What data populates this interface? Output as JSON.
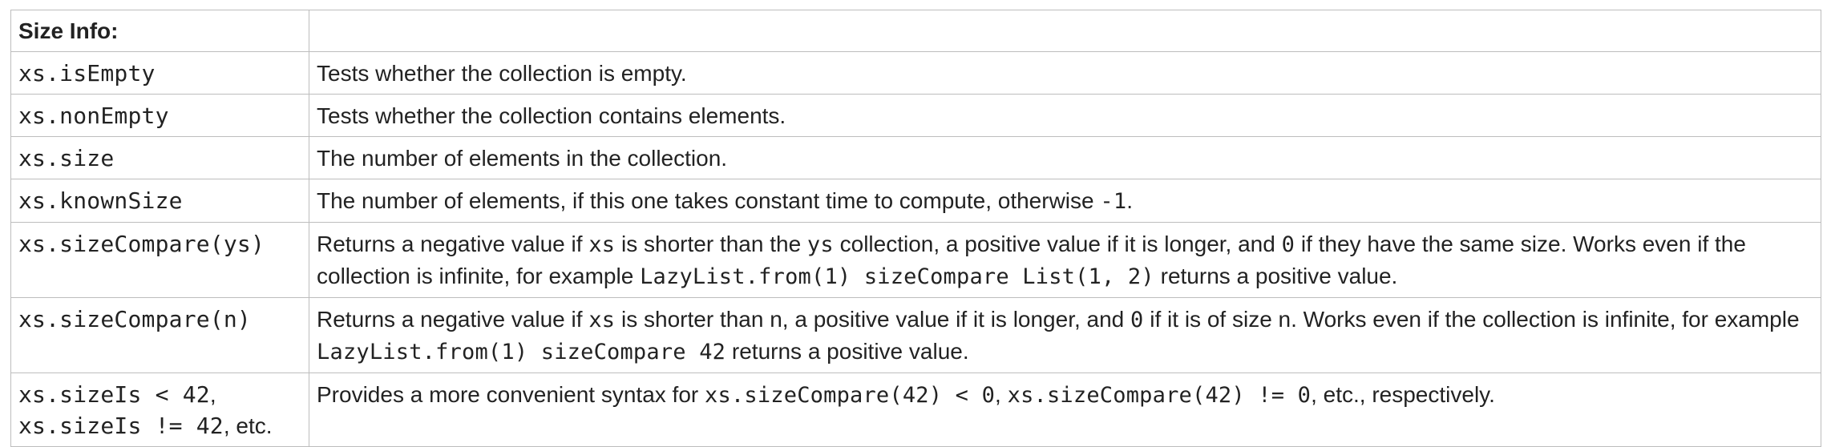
{
  "header": {
    "title": "Size Info:",
    "empty": ""
  },
  "rows": [
    {
      "op": "xs.isEmpty",
      "desc": "Tests whether the collection is empty."
    },
    {
      "op": "xs.nonEmpty",
      "desc": "Tests whether the collection contains elements."
    },
    {
      "op": "xs.size",
      "desc": "The number of elements in the collection."
    },
    {
      "op": "xs.knownSize",
      "desc_a": "The number of elements, if this one takes constant time to compute, otherwise ",
      "desc_code": "-1",
      "desc_b": "."
    },
    {
      "op": "xs.sizeCompare(ys)",
      "p1": "Returns a negative value if ",
      "c1": "xs",
      "p2": " is shorter than the ",
      "c2": "ys",
      "p3": " collection, a positive value if it is longer, and ",
      "c3": "0",
      "p4": " if they have the same size. Works even if the collection is infinite, for example ",
      "c4": "LazyList.from(1) sizeCompare List(1, 2)",
      "p5": " returns a positive value."
    },
    {
      "op": "xs.sizeCompare(n)",
      "p1": "Returns a negative value if ",
      "c1": "xs",
      "p2": " is shorter than n, a positive value if it is longer, and ",
      "c2": "0",
      "p3": " if it is of size n. Works even if the collection is infinite, for example ",
      "c3": "LazyList.from(1) sizeCompare 42",
      "p4": " returns a positive value."
    },
    {
      "op_a": "xs.sizeIs < 42",
      "op_sep": ",",
      "op_b": "xs.sizeIs != 42",
      "op_tail": ", etc.",
      "p1": "Provides a more convenient syntax for ",
      "c1": "xs.sizeCompare(42) < 0",
      "p2": ", ",
      "c2": "xs.sizeCompare(42) != 0",
      "p3": ", etc., respectively."
    }
  ]
}
